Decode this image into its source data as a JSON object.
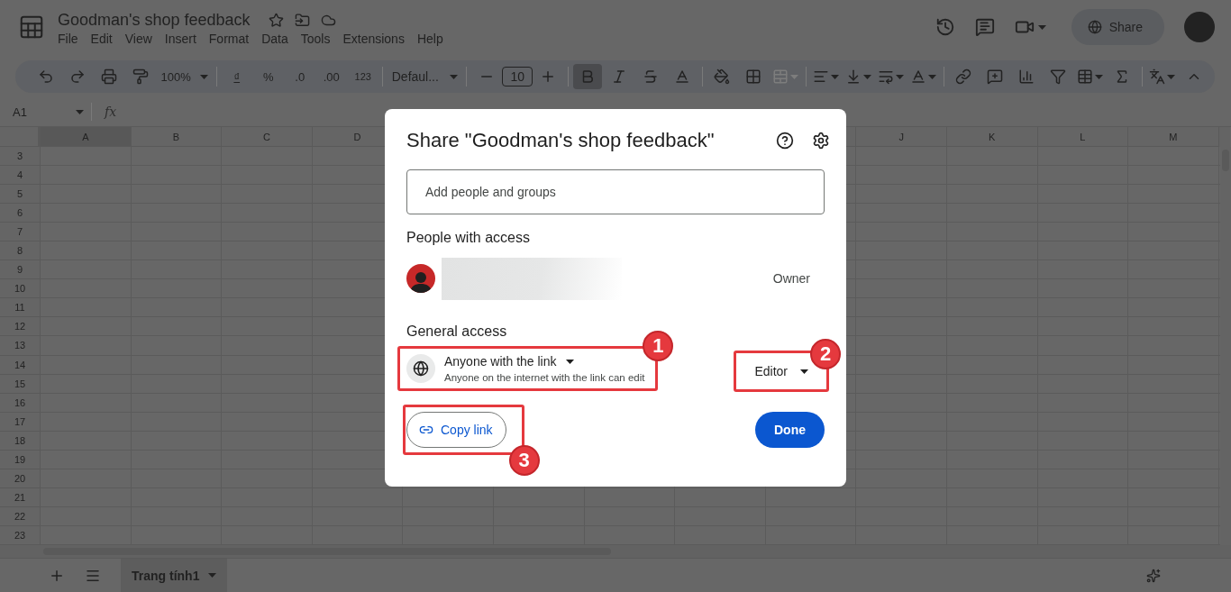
{
  "document": {
    "title": "Goodman's shop feedback"
  },
  "menu": [
    "File",
    "Edit",
    "View",
    "Insert",
    "Format",
    "Data",
    "Tools",
    "Extensions",
    "Help"
  ],
  "share_button": {
    "label": "Share"
  },
  "toolbar": {
    "zoom": "100%",
    "currency": "₫",
    "percent": "%",
    "decimal_decrease": ".0",
    "decimal_increase": ".00",
    "number_format": "123",
    "font": "Defaul...",
    "font_size": "10",
    "bold": true,
    "merge_disabled": true
  },
  "name_box": "A1",
  "formula_icon": "fx",
  "sheet": {
    "columns": [
      {
        "label": "A",
        "selected": true
      },
      {
        "label": "B",
        "selected": false
      },
      {
        "label": "C",
        "selected": false
      },
      {
        "label": "D",
        "selected": false
      },
      {
        "label": "J",
        "selected": false
      },
      {
        "label": "K",
        "selected": false
      },
      {
        "label": "L",
        "selected": false
      },
      {
        "label": "M",
        "selected": false
      }
    ],
    "rows": [
      "3",
      "4",
      "5",
      "6",
      "7",
      "8",
      "9",
      "10",
      "11",
      "12",
      "13",
      "14",
      "15",
      "16",
      "17",
      "18",
      "19",
      "20",
      "21",
      "22",
      "23"
    ]
  },
  "sheet_tabs": [
    {
      "label": "Trang tính1",
      "selected": true
    }
  ],
  "dialog": {
    "title": "Share \"Goodman's shop feedback\"",
    "add_field": {
      "placeholder": "Add people and groups"
    },
    "people_heading": "People with access",
    "people": [
      {
        "role": "Owner"
      }
    ],
    "general_heading": "General access",
    "access": {
      "label": "Anyone with the link",
      "description": "Anyone on the internet with the link can edit",
      "callout": "1"
    },
    "permission": {
      "label": "Editor",
      "callout": "2"
    },
    "copy_link": {
      "label": "Copy link",
      "callout": "3"
    },
    "done": {
      "label": "Done"
    }
  }
}
